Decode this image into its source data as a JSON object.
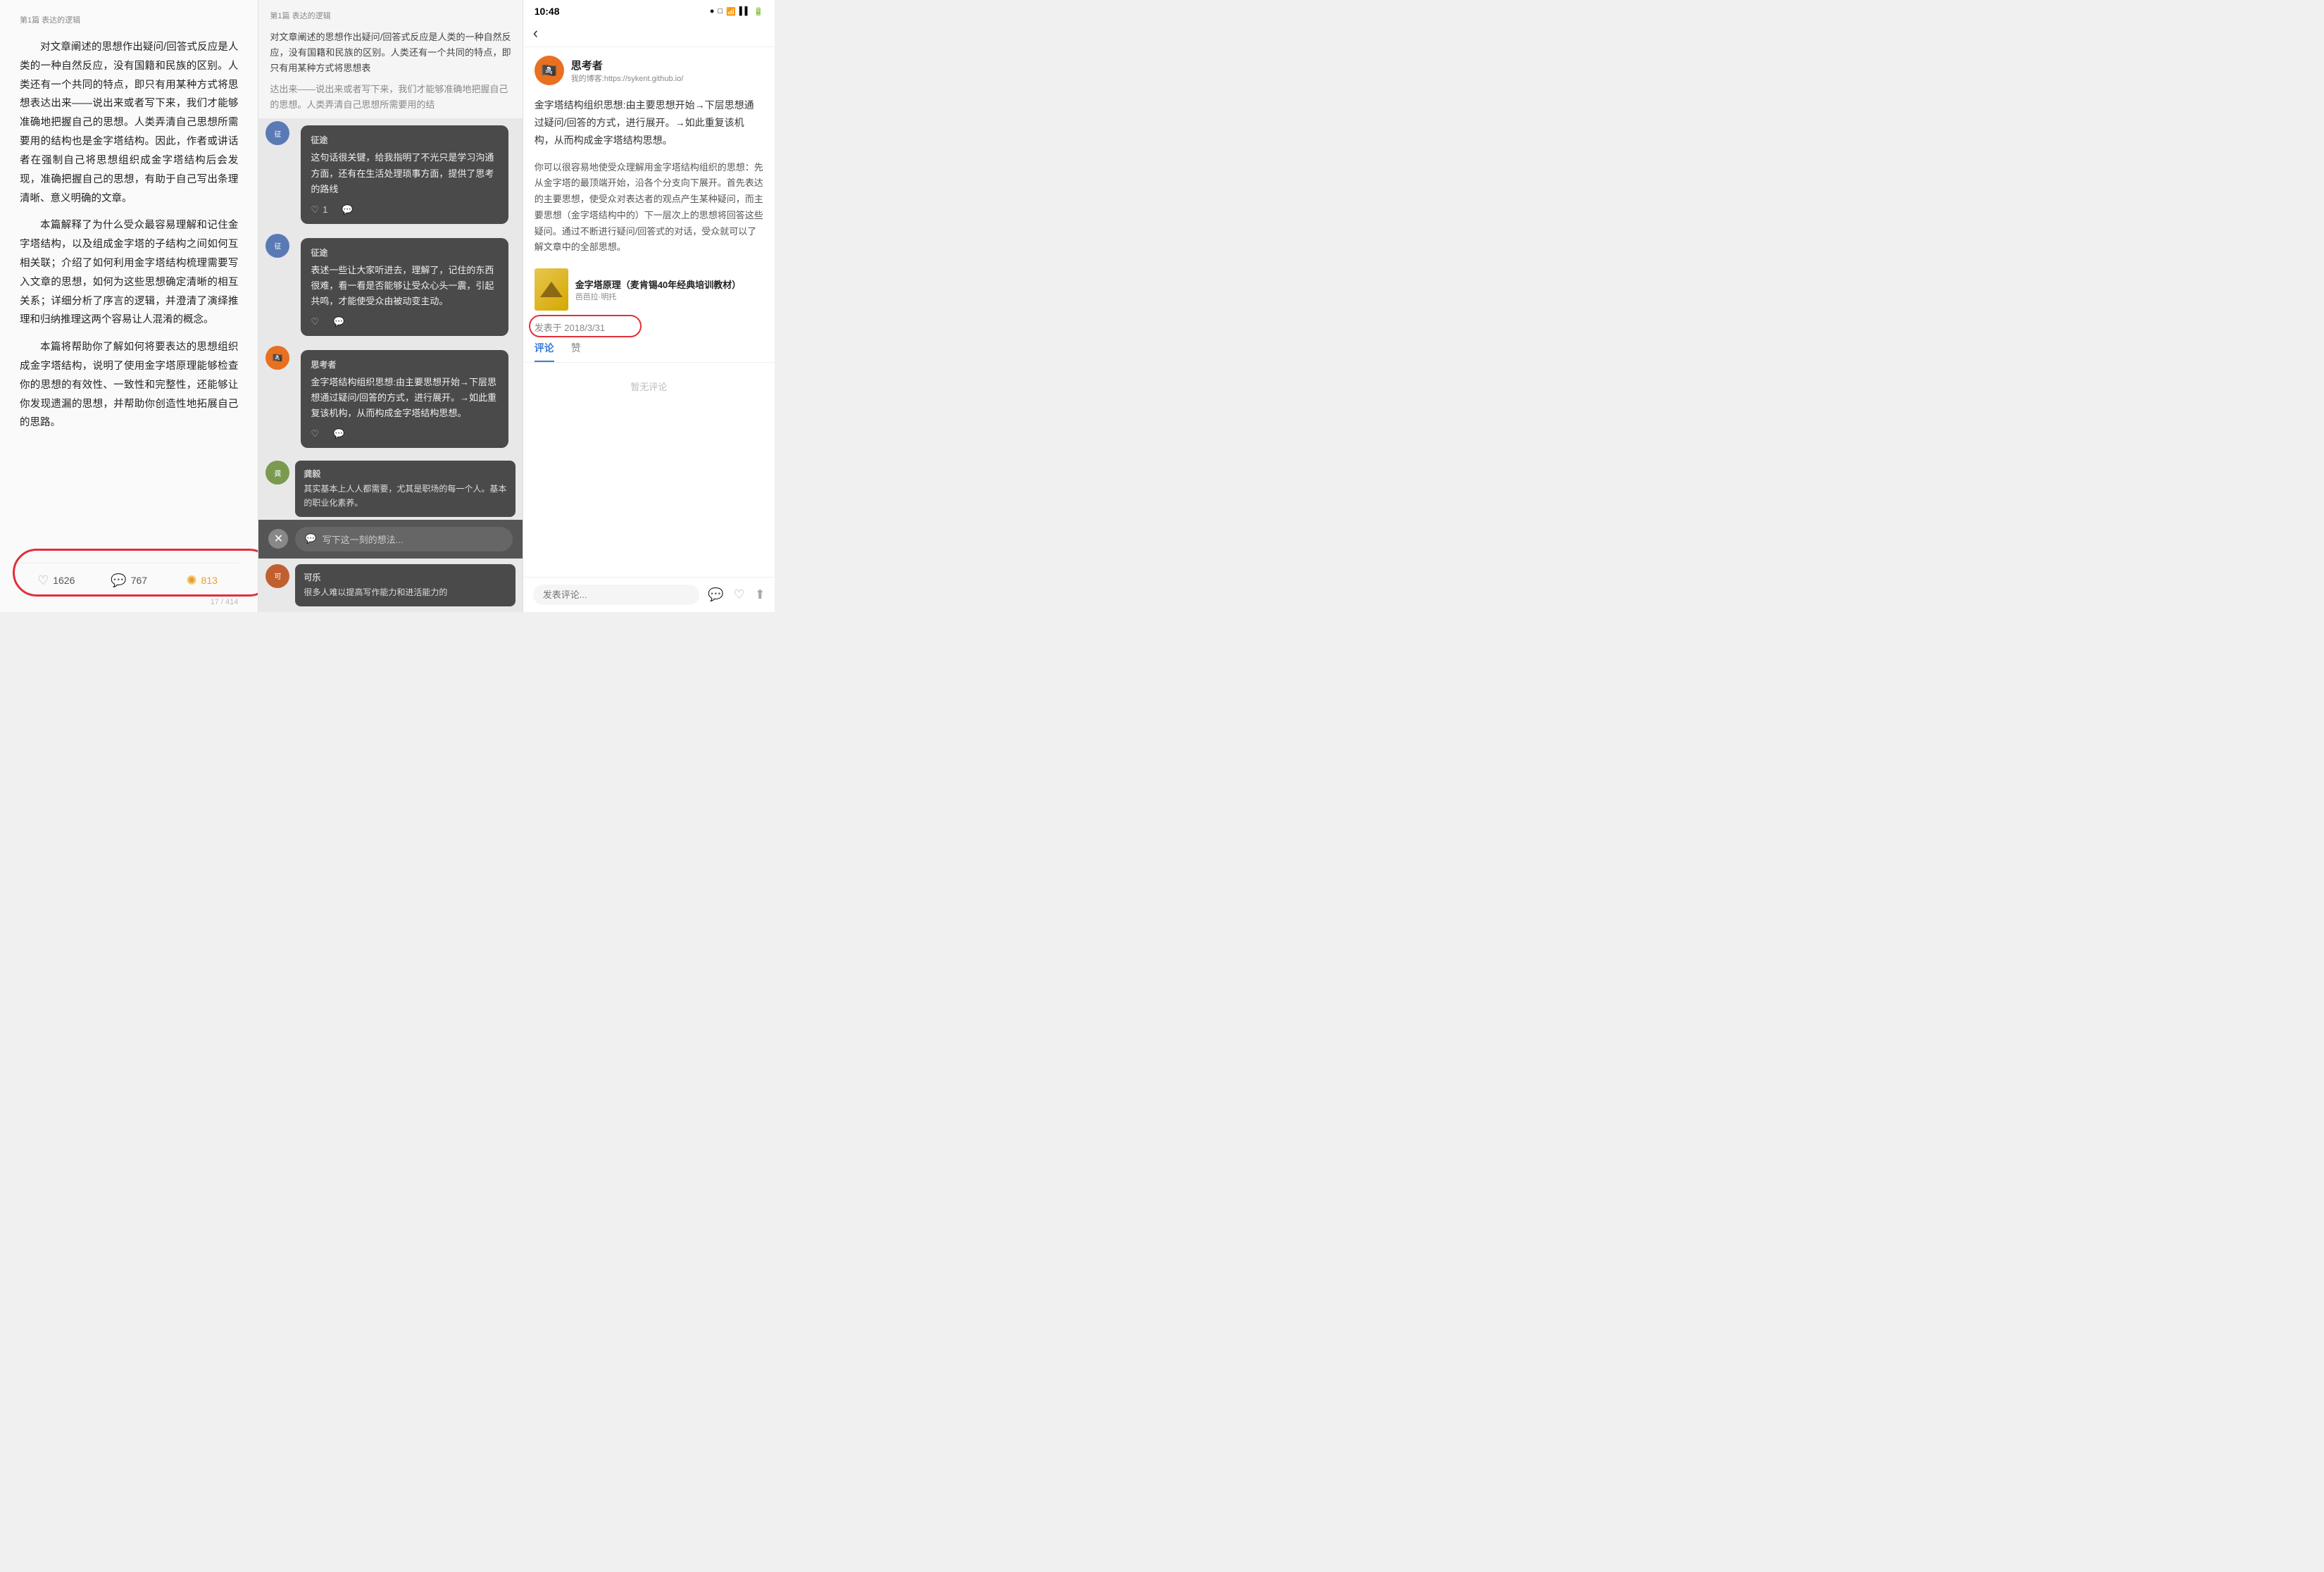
{
  "left": {
    "breadcrumb": "第1篇 表达的逻辑",
    "paragraphs": [
      "对文章阐述的思想作出疑问/回答式反应是人类的一种自然反应，没有国籍和民族的区别。人类还有一个共同的特点，即只有用某种方式将思想表达出来——说出来或者写下来，我们才能够准确地把握自己的思想。人类弄清自己思想所需要用的结构也是金字塔结构。因此，作者或讲话者在强制自己将思想组织成金字塔结构后会发现，准确把握自己的思想，有助于自己写出条理清晰、意义明确的文章。",
      "本篇解释了为什么受众最容易理解和记住金字塔结构，以及组成金字塔的子结构之间如何互相关联；介绍了如何利用金字塔结构梳理需要写入文章的思想，如何为这些思想确定清晰的相互关系；详细分析了序言的逻辑，并澄清了演绎推理和归纳推理这两个容易让人混淆的概念。",
      "本篇将帮助你了解如何将要表达的思想组织成金字塔结构，说明了使用金字塔原理能够检查你的思想的有效性、一致性和完整性，还能够让你发现遗漏的思想，并帮助你创造性地拓展自己的思路。"
    ],
    "footer": {
      "likes_count": "1626",
      "comments_count": "767",
      "shares_count": "813",
      "page_info": "17 / 414"
    }
  },
  "middle": {
    "breadcrumb": "第1篇 表达的逻辑",
    "original_snippet1": "对文章阐述的思想作出疑问/回答式反应是人类的一种自然反应，没有国籍和民族的区别。人类还有一个共同的特点，即只有用某种方式将思想表",
    "original_snippet2": "达出来——说出来或者写下来，我们才能够准确地把握自己的思想。人类弄清自己思想所需要用的结",
    "comments": [
      {
        "id": "c1",
        "author": "征途",
        "text": "这句话很关键，给我指明了不光只是学习沟通方面，还有在生活处理琐事方面，提供了思考的路线",
        "likes": "1",
        "has_reply": true
      },
      {
        "id": "c2",
        "author": "征途",
        "text": "表述一些让大家听进去，理解了，记住的东西很难，看一看是否能够让受众心头一震，引起共鸣，才能使受众由被动变主动。",
        "likes": "",
        "has_reply": true
      },
      {
        "id": "c3",
        "author": "思考者",
        "text": "金字塔结构组织思想:由主要思想开始→下层思想通过疑问/回答的方式，进行展开。→如此重复该机构，从而构成金字塔结构思想。",
        "likes": "",
        "has_reply": true
      }
    ],
    "bottom_comment": {
      "author": "龚毅",
      "text": "其实基本上人人都需要，尤其是职场的每一个人。基本的职业化素养。"
    },
    "bottom_comment2": {
      "author": "可乐",
      "text": "很多人难以提高写作能力和进活能力的"
    },
    "input_placeholder": "写下这一刻的想法..."
  },
  "right": {
    "status_bar": {
      "time": "10:48",
      "icons": [
        "●",
        "□",
        "wifi",
        "signal",
        "signal2",
        "battery"
      ]
    },
    "author": {
      "name": "思考者",
      "blog": "我的博客:https://sykent.github.io/"
    },
    "main_text": "金字塔结构组织思想:由主要思想开始→下层思想通过疑问/回答的方式，进行展开。→如此重复该机构，从而构成金字塔结构思想。",
    "sub_text": "你可以很容易地使受众理解用金字塔结构组织的思想：先从金字塔的最顶端开始，沿各个分支向下展开。首先表达的主要思想，使受众对表达者的观点产生某种疑问，而主要思想（金字塔结构中的）下一层次上的思想将回答这些疑问。通过不断进行疑问/回答式的对话，受众就可以了解文章中的全部思想。",
    "book": {
      "title": "金字塔原理（麦肯锡40年经典培训教材）",
      "subtitle": "芭芭拉·明托"
    },
    "date": "发表于 2018/3/31",
    "tabs": [
      "评论",
      "赞"
    ],
    "active_tab": "评论",
    "no_comment": "暂无评论",
    "comment_placeholder": "发表评论..."
  }
}
